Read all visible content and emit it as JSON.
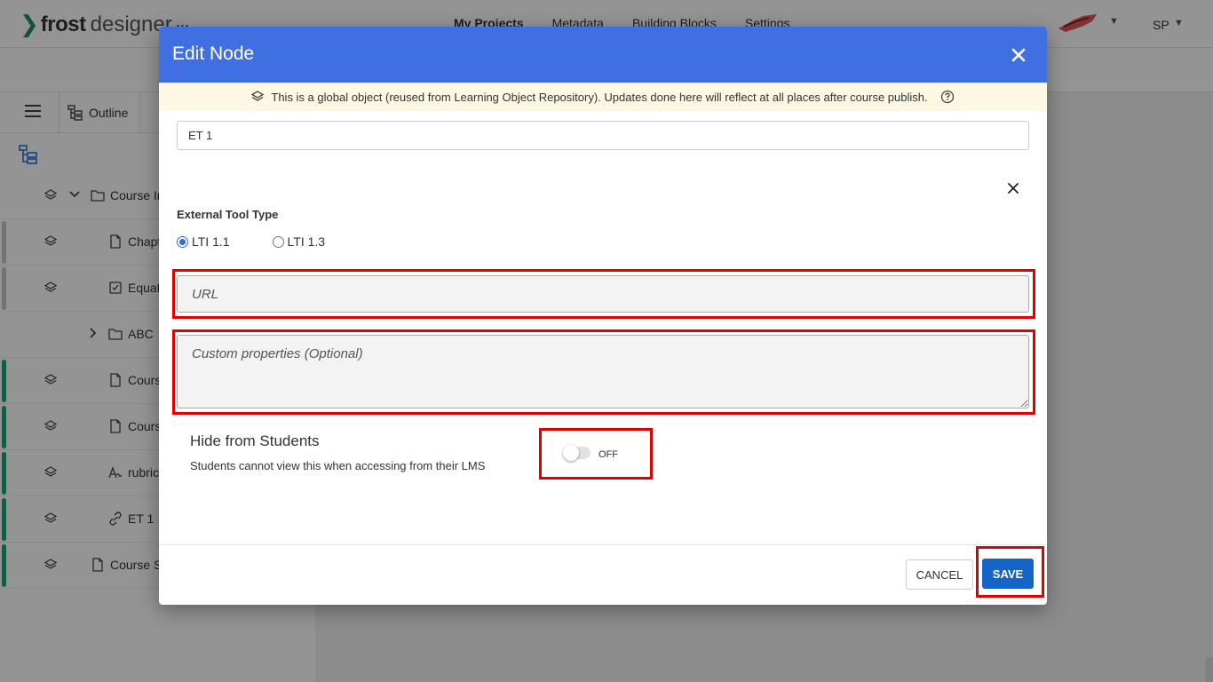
{
  "app": {
    "logo_word": "frost",
    "logo_suffix": "designer",
    "menu_dots": "...",
    "nav": [
      "My Projects",
      "Metadata",
      "Building Blocks",
      "Settings"
    ],
    "user_initials": "SP"
  },
  "toolbar": {
    "outline_label": "Outline"
  },
  "tree": [
    {
      "label": "Course Ir",
      "icon": "folder-icon",
      "has_bar": false,
      "green": false,
      "indent": 1,
      "expanded": true
    },
    {
      "label": "Chapt",
      "icon": "file-icon",
      "has_bar": true,
      "green": false,
      "indent": 2
    },
    {
      "label": "Equat",
      "icon": "checklist-icon",
      "has_bar": true,
      "green": false,
      "indent": 2
    },
    {
      "label": "ABC",
      "icon": "folder-icon",
      "has_bar": false,
      "green": false,
      "indent": 2,
      "collapsed": true
    },
    {
      "label": "Cours",
      "icon": "file-icon",
      "has_bar": true,
      "green": true,
      "indent": 2
    },
    {
      "label": "Cours",
      "icon": "file-icon",
      "has_bar": true,
      "green": true,
      "indent": 2
    },
    {
      "label": "rubric",
      "icon": "rubric-icon",
      "has_bar": true,
      "green": true,
      "indent": 2
    },
    {
      "label": "ET 1",
      "icon": "link-icon",
      "has_bar": true,
      "green": true,
      "indent": 2
    },
    {
      "label": "Course S",
      "icon": "file-icon",
      "has_bar": true,
      "green": true,
      "indent": 1
    }
  ],
  "modal": {
    "title": "Edit Node",
    "banner_text": "This is a global object (reused from Learning Object Repository). Updates done here will reflect at all places after course publish.",
    "node_title_value": "ET 1",
    "external_tool_type_label": "External Tool Type",
    "radio_options": [
      {
        "label": "LTI 1.1",
        "checked": true
      },
      {
        "label": "LTI 1.3",
        "checked": false
      }
    ],
    "url_placeholder": "URL",
    "custom_properties_placeholder": "Custom properties (Optional)",
    "hide_title": "Hide from Students",
    "hide_description": "Students cannot view this when accessing from their LMS",
    "toggle_state": "OFF",
    "cancel_label": "CANCEL",
    "save_label": "SAVE"
  },
  "colors": {
    "header_blue": "#3f6fe0",
    "save_blue": "#1565c8",
    "highlight_red": "#e00000",
    "banner_bg": "#fdf8e3",
    "tree_green": "#1aa37a"
  }
}
